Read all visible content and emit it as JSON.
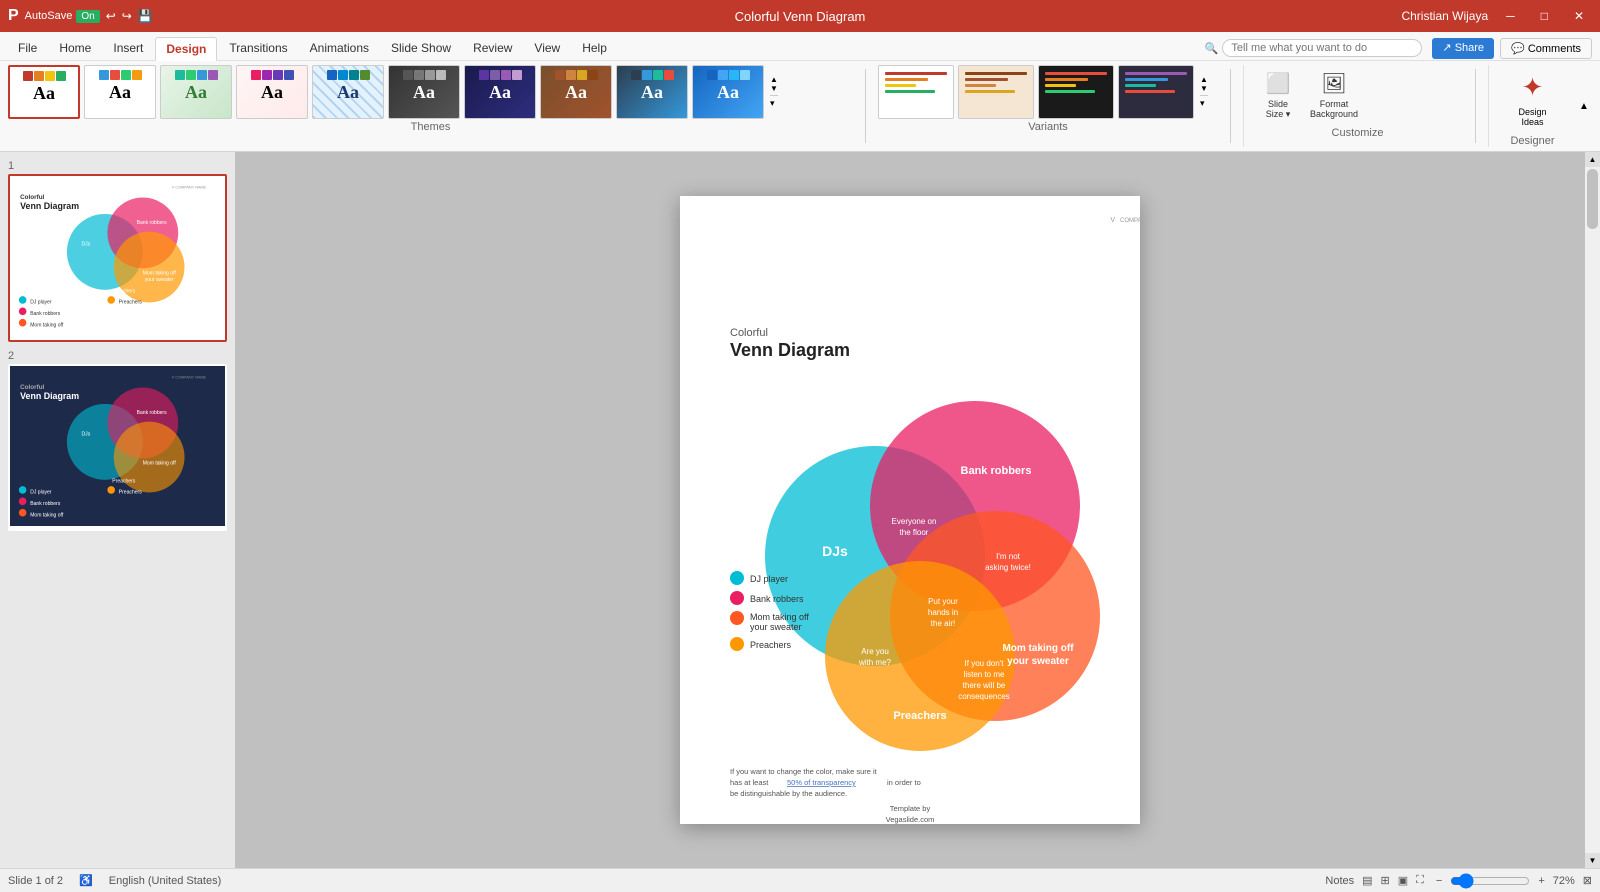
{
  "titlebar": {
    "autosave_label": "AutoSave",
    "autosave_state": "On",
    "title": "Colorful Venn Diagram",
    "user": "Christian Wijaya",
    "min_label": "─",
    "max_label": "□",
    "close_label": "✕"
  },
  "menu": {
    "items": [
      {
        "label": "File",
        "id": "file"
      },
      {
        "label": "Home",
        "id": "home"
      },
      {
        "label": "Insert",
        "id": "insert"
      },
      {
        "label": "Design",
        "id": "design",
        "active": true
      },
      {
        "label": "Transitions",
        "id": "transitions"
      },
      {
        "label": "Animations",
        "id": "animations"
      },
      {
        "label": "Slide Show",
        "id": "slideshow"
      },
      {
        "label": "Review",
        "id": "review"
      },
      {
        "label": "View",
        "id": "view"
      },
      {
        "label": "Help",
        "id": "help"
      }
    ],
    "search_placeholder": "Tell me what you want to do",
    "share_label": "Share",
    "comments_label": "Comments"
  },
  "themes": {
    "label": "Themes",
    "items": [
      {
        "label": "Aa",
        "id": "theme-office"
      },
      {
        "label": "Aa",
        "id": "theme-2"
      },
      {
        "label": "Aa",
        "id": "theme-3"
      },
      {
        "label": "Aa",
        "id": "theme-4"
      },
      {
        "label": "Aa",
        "id": "theme-5"
      },
      {
        "label": "Aa",
        "id": "theme-6"
      },
      {
        "label": "Aa",
        "id": "theme-7"
      },
      {
        "label": "Aa",
        "id": "theme-8"
      },
      {
        "label": "Aa",
        "id": "theme-9"
      },
      {
        "label": "Aa",
        "id": "theme-10"
      }
    ]
  },
  "variants": {
    "label": "Variants",
    "items": [
      {
        "id": "var-1"
      },
      {
        "id": "var-2"
      },
      {
        "id": "var-3"
      },
      {
        "id": "var-4"
      }
    ]
  },
  "customize": {
    "label": "Customize",
    "slide_size_label": "Slide\nSize",
    "format_bg_label": "Format\nBackground",
    "design_ideas_label": "Design\nIdeas"
  },
  "slide_panel": {
    "slides": [
      {
        "number": "1",
        "active": true
      },
      {
        "number": "2",
        "active": false
      }
    ]
  },
  "slide": {
    "company_name": "COMPANY NAME",
    "title_small": "Colorful",
    "title_large": "Venn Diagram",
    "djs_label": "DJs",
    "bank_robbers_label": "Bank robbers",
    "mom_label": "Mom taking off\nyour sweater",
    "preachers_label": "Preachers",
    "everyone_label": "Everyone on\nthe floor",
    "not_asking_label": "I'm not\nasking twice!",
    "put_hands_label": "Put your\nhands in\nthe air!",
    "are_you_label": "Are you\nwith me?",
    "consequences_label": "If you don't\nlisten to me\nthere will be\nconsequences",
    "legend_dj": "DJ player",
    "legend_bank": "Bank robbers",
    "legend_mom": "Mom taking off\nyour sweater",
    "legend_preachers": "Preachers",
    "footer_text": "If you want to change the color, make sure it has at least 50% of transparency in order to be distinguishable by the audience.",
    "template_by": "Template by\nVegaslide.com"
  },
  "statusbar": {
    "slide_info": "Slide 1 of 2",
    "language": "English (United States)",
    "notes_label": "Notes",
    "zoom_level": "72%",
    "zoom_in": "+",
    "zoom_out": "-"
  }
}
